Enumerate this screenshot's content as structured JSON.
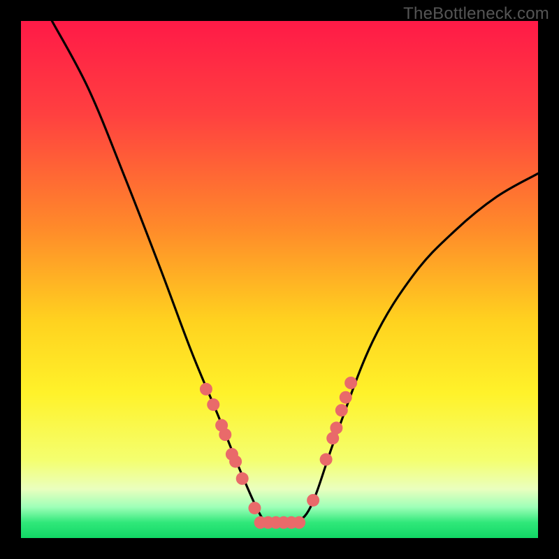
{
  "watermark": "TheBottleneck.com",
  "plot": {
    "inner_x": 30,
    "inner_y": 30,
    "inner_w": 740,
    "inner_h": 740
  },
  "gradient_stops": [
    {
      "offset": 0.0,
      "color": "#ff1a47"
    },
    {
      "offset": 0.18,
      "color": "#ff4040"
    },
    {
      "offset": 0.4,
      "color": "#ff8a2a"
    },
    {
      "offset": 0.58,
      "color": "#ffd21f"
    },
    {
      "offset": 0.72,
      "color": "#fff22a"
    },
    {
      "offset": 0.85,
      "color": "#f4ff70"
    },
    {
      "offset": 0.905,
      "color": "#eaffbe"
    },
    {
      "offset": 0.94,
      "color": "#9fffb8"
    },
    {
      "offset": 0.97,
      "color": "#30e87a"
    },
    {
      "offset": 1.0,
      "color": "#11d765"
    }
  ],
  "markers": {
    "color": "#e96a6a",
    "radius": 9,
    "points_uv": [
      {
        "u": 0.358,
        "v": 0.288
      },
      {
        "u": 0.372,
        "v": 0.258
      },
      {
        "u": 0.388,
        "v": 0.218
      },
      {
        "u": 0.395,
        "v": 0.2
      },
      {
        "u": 0.408,
        "v": 0.162
      },
      {
        "u": 0.415,
        "v": 0.148
      },
      {
        "u": 0.428,
        "v": 0.115
      },
      {
        "u": 0.452,
        "v": 0.058
      },
      {
        "u": 0.463,
        "v": 0.03
      },
      {
        "u": 0.478,
        "v": 0.03
      },
      {
        "u": 0.493,
        "v": 0.03
      },
      {
        "u": 0.508,
        "v": 0.03
      },
      {
        "u": 0.523,
        "v": 0.03
      },
      {
        "u": 0.538,
        "v": 0.03
      },
      {
        "u": 0.565,
        "v": 0.073
      },
      {
        "u": 0.59,
        "v": 0.152
      },
      {
        "u": 0.603,
        "v": 0.193
      },
      {
        "u": 0.61,
        "v": 0.213
      },
      {
        "u": 0.62,
        "v": 0.247
      },
      {
        "u": 0.628,
        "v": 0.272
      },
      {
        "u": 0.638,
        "v": 0.3
      }
    ]
  },
  "chart_data": {
    "type": "line",
    "title": "",
    "xlabel": "",
    "ylabel": "",
    "xlim": [
      0,
      1
    ],
    "ylim": [
      0,
      1
    ],
    "note": "Axes are unlabeled; u,v are normalized plot coordinates (u: left→right, v: bottom→top). Curve is a V-shaped valley; markers cluster near the valley floor.",
    "series": [
      {
        "name": "bottleneck-curve",
        "points_uv": [
          {
            "u": 0.06,
            "v": 1.0
          },
          {
            "u": 0.13,
            "v": 0.87
          },
          {
            "u": 0.2,
            "v": 0.7
          },
          {
            "u": 0.27,
            "v": 0.52
          },
          {
            "u": 0.33,
            "v": 0.36
          },
          {
            "u": 0.38,
            "v": 0.24
          },
          {
            "u": 0.42,
            "v": 0.14
          },
          {
            "u": 0.455,
            "v": 0.06
          },
          {
            "u": 0.475,
            "v": 0.03
          },
          {
            "u": 0.5,
            "v": 0.025
          },
          {
            "u": 0.525,
            "v": 0.03
          },
          {
            "u": 0.56,
            "v": 0.06
          },
          {
            "u": 0.61,
            "v": 0.2
          },
          {
            "u": 0.68,
            "v": 0.38
          },
          {
            "u": 0.76,
            "v": 0.51
          },
          {
            "u": 0.84,
            "v": 0.595
          },
          {
            "u": 0.92,
            "v": 0.66
          },
          {
            "u": 1.0,
            "v": 0.705
          }
        ]
      },
      {
        "name": "markers",
        "points_uv": [
          {
            "u": 0.358,
            "v": 0.288
          },
          {
            "u": 0.372,
            "v": 0.258
          },
          {
            "u": 0.388,
            "v": 0.218
          },
          {
            "u": 0.395,
            "v": 0.2
          },
          {
            "u": 0.408,
            "v": 0.162
          },
          {
            "u": 0.415,
            "v": 0.148
          },
          {
            "u": 0.428,
            "v": 0.115
          },
          {
            "u": 0.452,
            "v": 0.058
          },
          {
            "u": 0.463,
            "v": 0.03
          },
          {
            "u": 0.478,
            "v": 0.03
          },
          {
            "u": 0.493,
            "v": 0.03
          },
          {
            "u": 0.508,
            "v": 0.03
          },
          {
            "u": 0.523,
            "v": 0.03
          },
          {
            "u": 0.538,
            "v": 0.03
          },
          {
            "u": 0.565,
            "v": 0.073
          },
          {
            "u": 0.59,
            "v": 0.152
          },
          {
            "u": 0.603,
            "v": 0.193
          },
          {
            "u": 0.61,
            "v": 0.213
          },
          {
            "u": 0.62,
            "v": 0.247
          },
          {
            "u": 0.628,
            "v": 0.272
          },
          {
            "u": 0.638,
            "v": 0.3
          }
        ]
      }
    ]
  }
}
